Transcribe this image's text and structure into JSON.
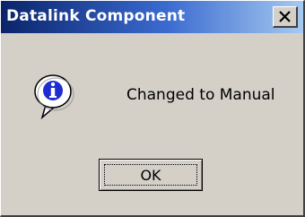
{
  "window": {
    "title": "Datalink Component"
  },
  "dialog": {
    "icon": "information-icon",
    "message": "Changed to Manual",
    "ok_label": "OK"
  },
  "colors": {
    "titlebar_start": "#0a246a",
    "titlebar_end": "#a6caf0",
    "face": "#d4d0c8"
  }
}
